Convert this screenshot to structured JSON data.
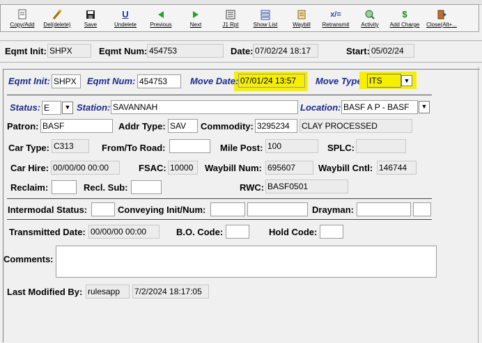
{
  "toolbar": {
    "items": [
      {
        "label": "Copy/Add",
        "icon": "copy-icon"
      },
      {
        "label": "Del(delete)",
        "icon": "delete-icon"
      },
      {
        "label": "Save",
        "icon": "save-icon"
      },
      {
        "label": "Undelete",
        "icon": "undelete-icon"
      },
      {
        "label": "Previous",
        "icon": "previous-icon"
      },
      {
        "label": "Next",
        "icon": "next-icon"
      },
      {
        "label": "J1 Rpt",
        "icon": "report-icon"
      },
      {
        "label": "Show List",
        "icon": "list-icon"
      },
      {
        "label": "Waybill",
        "icon": "waybill-icon"
      },
      {
        "label": "Retransmit",
        "icon": "retransmit-icon"
      },
      {
        "label": "Activity",
        "icon": "activity-icon"
      },
      {
        "label": "Add Charge",
        "icon": "charge-icon"
      },
      {
        "label": "Close(Alt+...",
        "icon": "close-icon"
      }
    ]
  },
  "header": {
    "eqmt_init_label": "Eqmt Init:",
    "eqmt_init": "SHPX",
    "eqmt_num_label": "Eqmt Num:",
    "eqmt_num": "454753",
    "date_label": "Date:",
    "date": "07/02/24 18:17",
    "start_label": "Start:",
    "start": "05/02/24"
  },
  "form": {
    "eqmt_init_label": "Eqmt Init:",
    "eqmt_init": "SHPX",
    "eqmt_num_label": "Eqmt Num:",
    "eqmt_num": "454753",
    "move_date_label": "Move Date:",
    "move_date": "07/01/24 13:57",
    "move_type_label": "Move Type:",
    "move_type": "ITS",
    "status_label": "Status:",
    "status": "E",
    "station_label": "Station:",
    "station": "SAVANNAH",
    "location_label": "Location:",
    "location": "BASF A P - BASF",
    "patron_label": "Patron:",
    "patron": "BASF",
    "addr_type_label": "Addr Type:",
    "addr_type": "SAV",
    "commodity_label": "Commodity:",
    "commodity_code": "3295234",
    "commodity_desc": "CLAY PROCESSED",
    "car_type_label": "Car Type:",
    "car_type": "C313",
    "from_to_road_label": "From/To Road:",
    "from_to_road": "",
    "mile_post_label": "Mile Post:",
    "mile_post": "100",
    "splc_label": "SPLC:",
    "splc": "",
    "car_hire_label": "Car Hire:",
    "car_hire": "00/00/00 00:00",
    "fsac_label": "FSAC:",
    "fsac": "10000",
    "waybill_num_label": "Waybill Num:",
    "waybill_num": "695607",
    "waybill_cntl_label": "Waybill Cntl:",
    "waybill_cntl": "146744",
    "reclaim_label": "Reclaim:",
    "reclaim": "",
    "recl_sub_label": "Recl. Sub:",
    "recl_sub": "",
    "rwc_label": "RWC:",
    "rwc": "BASF0501",
    "intermodal_status_label": "Intermodal Status:",
    "intermodal_status": "",
    "conveying_label": "Conveying Init/Num:",
    "conveying_init": "",
    "conveying_num": "",
    "drayman_label": "Drayman:",
    "drayman_1": "",
    "drayman_2": "",
    "transmitted_date_label": "Transmitted Date:",
    "transmitted_date": "00/00/00 00:00",
    "bo_code_label": "B.O. Code:",
    "bo_code": "",
    "hold_code_label": "Hold Code:",
    "hold_code": "",
    "comments_label": "Comments:",
    "comments": "",
    "last_modified_label": "Last Modified By:",
    "last_modified_by": "rulesapp",
    "last_modified_at": "7/2/2024 18:17:05"
  },
  "colors": {
    "highlight": "#f6f000",
    "field_label_blue": "#1a2a8c"
  }
}
